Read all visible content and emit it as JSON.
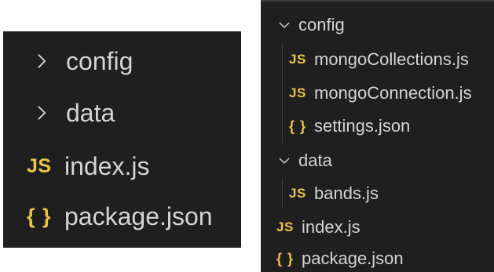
{
  "colors": {
    "panel_bg": "#1f1f20",
    "text": "#d4d4d4",
    "js_icon": "#e8c547",
    "json_icon": "#e8c547",
    "chevron": "#d4d4d4"
  },
  "collapsed_tree": {
    "items": [
      {
        "label": "config",
        "icon": "chevron-right-icon",
        "type": "folder",
        "expanded": false
      },
      {
        "label": "data",
        "icon": "chevron-right-icon",
        "type": "folder",
        "expanded": false
      },
      {
        "label": "index.js",
        "icon_text": "JS",
        "icon": "js-file-icon",
        "type": "file"
      },
      {
        "label": "package.json",
        "icon_text": "{ }",
        "icon": "json-file-icon",
        "type": "file"
      }
    ]
  },
  "expanded_tree": {
    "items": [
      {
        "label": "config",
        "icon": "chevron-down-icon",
        "type": "folder",
        "expanded": true
      },
      {
        "label": "mongoCollections.js",
        "icon_text": "JS",
        "icon": "js-file-icon",
        "type": "file"
      },
      {
        "label": "mongoConnection.js",
        "icon_text": "JS",
        "icon": "js-file-icon",
        "type": "file"
      },
      {
        "label": "settings.json",
        "icon_text": "{ }",
        "icon": "json-file-icon",
        "type": "file"
      },
      {
        "label": "data",
        "icon": "chevron-down-icon",
        "type": "folder",
        "expanded": true
      },
      {
        "label": "bands.js",
        "icon_text": "JS",
        "icon": "js-file-icon",
        "type": "file"
      },
      {
        "label": "index.js",
        "icon_text": "JS",
        "icon": "js-file-icon",
        "type": "file"
      },
      {
        "label": "package.json",
        "icon_text": "{ }",
        "icon": "json-file-icon",
        "type": "file"
      }
    ]
  }
}
